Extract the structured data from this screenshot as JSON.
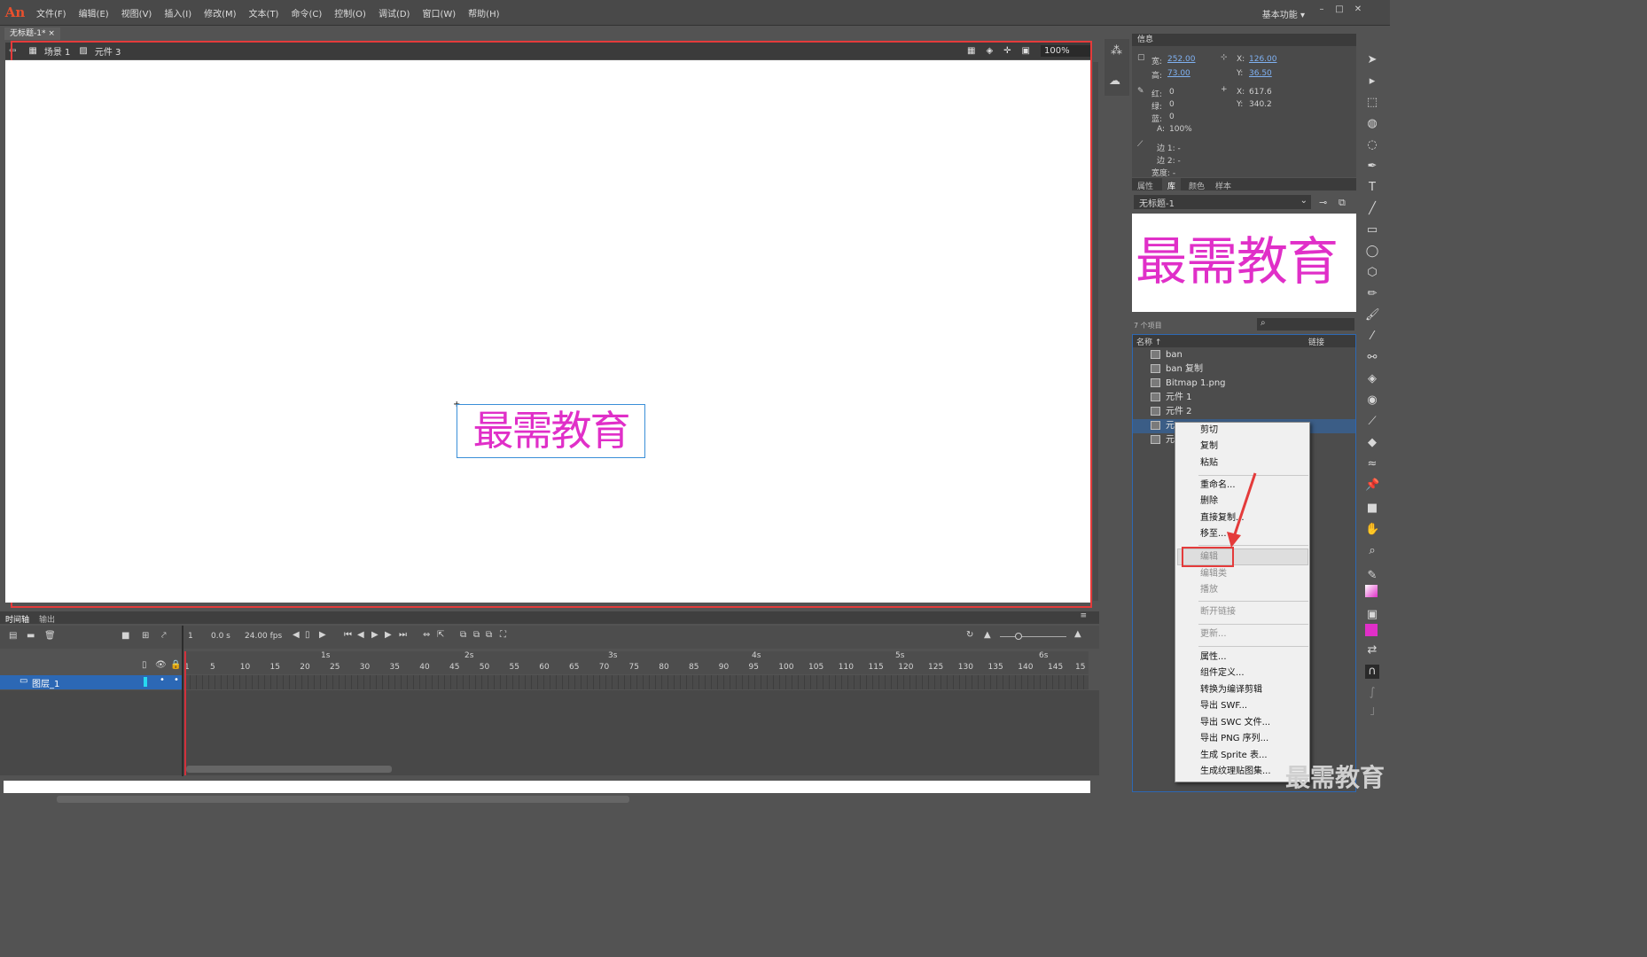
{
  "app": {
    "logo": "An",
    "workspace": "基本功能 ▾"
  },
  "menu": [
    "文件(F)",
    "编辑(E)",
    "视图(V)",
    "插入(I)",
    "修改(M)",
    "文本(T)",
    "命令(C)",
    "控制(O)",
    "调试(D)",
    "窗口(W)",
    "帮助(H)"
  ],
  "document_tab": "无标题-1*",
  "editbar": {
    "scene": "场景 1",
    "symbol": "元件 3",
    "zoom": "100%"
  },
  "stage": {
    "text": "最需教育",
    "text_color": "#e02fc8"
  },
  "timeline": {
    "tabs": [
      "时间轴",
      "输出"
    ],
    "frame": "1",
    "time": "0.0 s",
    "fps": "24.00 fps",
    "second_marks": [
      "1s",
      "2s",
      "3s",
      "4s",
      "5s",
      "6s"
    ],
    "frame_numbers": [
      "1",
      "5",
      "10",
      "15",
      "20",
      "25",
      "30",
      "35",
      "40",
      "45",
      "50",
      "55",
      "60",
      "65",
      "70",
      "75",
      "80",
      "85",
      "90",
      "95",
      "100",
      "105",
      "110",
      "115",
      "120",
      "125",
      "130",
      "135",
      "140",
      "145",
      "15"
    ],
    "layer_name": "图层_1"
  },
  "info_panel": {
    "title": "信息",
    "width_label": "宽:",
    "width": "252.00",
    "height_label": "高:",
    "height": "73.00",
    "x_label": "X:",
    "x": "126.00",
    "y_label": "Y:",
    "y": "36.50",
    "r_label": "红:",
    "r": "0",
    "g_label": "绿:",
    "g": "0",
    "b_label": "蓝:",
    "b": "0",
    "a_label": "A:",
    "a": "100%",
    "cursor_x": "617.6",
    "cursor_y": "340.2",
    "edge1": "边 1: -",
    "edge2": "边 2: -",
    "span": "宽度: -"
  },
  "library": {
    "tabs": [
      "属性",
      "库",
      "颜色",
      "样本"
    ],
    "doc": "无标题-1",
    "preview_text": "最需教育",
    "count": "7 个项目",
    "col_name": "名称 ↑",
    "col_link": "链接",
    "items": [
      "ban",
      "ban 复制",
      "Bitmap 1.png",
      "元件 1",
      "元件 2",
      "元",
      "元"
    ]
  },
  "context_menu": [
    {
      "label": "剪切",
      "enabled": true
    },
    {
      "label": "复制",
      "enabled": true
    },
    {
      "label": "粘贴",
      "enabled": true
    },
    {
      "label": "重命名...",
      "enabled": true
    },
    {
      "label": "删除",
      "enabled": true
    },
    {
      "label": "直接复制...",
      "enabled": true
    },
    {
      "label": "移至...",
      "enabled": true
    },
    {
      "label": "编辑",
      "enabled": false
    },
    {
      "label": "编辑类",
      "enabled": false
    },
    {
      "label": "播放",
      "enabled": false
    },
    {
      "label": "断开链接",
      "enabled": false
    },
    {
      "label": "更新...",
      "enabled": false
    },
    {
      "label": "属性...",
      "enabled": true
    },
    {
      "label": "组件定义...",
      "enabled": true
    },
    {
      "label": "转换为编译剪辑",
      "enabled": true
    },
    {
      "label": "导出 SWF...",
      "enabled": true
    },
    {
      "label": "导出 SWC 文件...",
      "enabled": true
    },
    {
      "label": "导出 PNG 序列...",
      "enabled": true
    },
    {
      "label": "生成 Sprite 表...",
      "enabled": true
    },
    {
      "label": "生成纹理贴图集...",
      "enabled": true
    }
  ],
  "watermark": "最需教育",
  "colors": {
    "accent_red": "#e43b3b",
    "selection_blue": "#2c68b5",
    "magenta": "#e02fc8"
  }
}
